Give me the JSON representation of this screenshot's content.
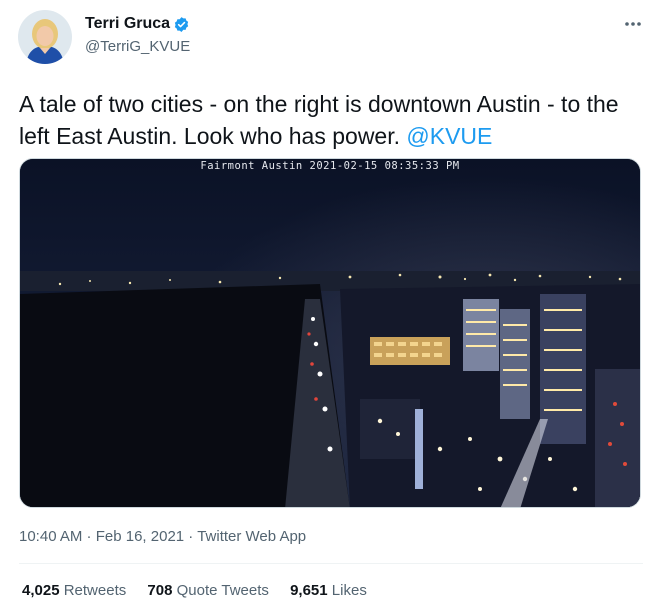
{
  "author": {
    "name": "Terri Gruca",
    "handle": "@TerriG_KVUE",
    "verified": true
  },
  "tweet": {
    "text": "A tale of two cities - on the right is downtown Austin - to the left East Austin. Look who has power. ",
    "mention": "@KVUE"
  },
  "media": {
    "camera_caption": "Fairmont Austin  2021-02-15  08:35:33 PM"
  },
  "meta": {
    "time": "10:40 AM",
    "separator1": " · ",
    "date": "Feb 16, 2021",
    "separator2": " · ",
    "source": "Twitter Web App"
  },
  "stats": {
    "retweets_count": "4,025",
    "retweets_label": "Retweets",
    "quotes_count": "708",
    "quotes_label": "Quote Tweets",
    "likes_count": "9,651",
    "likes_label": "Likes"
  },
  "colors": {
    "accent": "#1d9bf0",
    "secondary_text": "#536471",
    "divider": "#eff3f4"
  },
  "icons": [
    "verified-badge-icon",
    "more-options-icon"
  ]
}
